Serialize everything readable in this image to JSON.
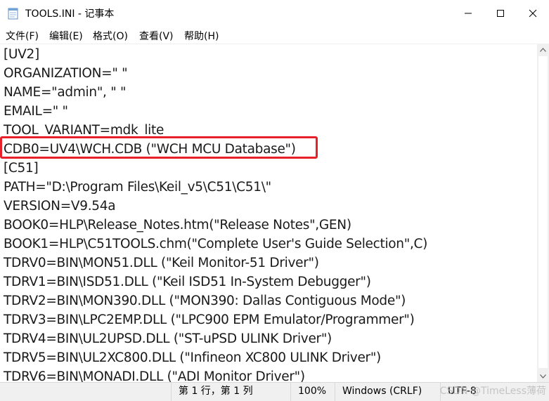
{
  "window": {
    "title": "TOOLS.INI - 记事本",
    "icon": "notepad-icon"
  },
  "menu": [
    "文件(F)",
    "编辑(E)",
    "格式(O)",
    "查看(V)",
    "帮助(H)"
  ],
  "editor_lines": [
    "[UV2]",
    "ORGANIZATION=\" \"",
    "NAME=\"admin\", \" \"",
    "EMAIL=\" \"",
    "TOOL_VARIANT=mdk_lite",
    "CDB0=UV4\\WCH.CDB (\"WCH MCU Database\")",
    "[C51]",
    "PATH=\"D:\\Program Files\\Keil_v5\\C51\\C51\\\"",
    "VERSION=V9.54a",
    "BOOK0=HLP\\Release_Notes.htm(\"Release Notes\",GEN)",
    "BOOK1=HLP\\C51TOOLS.chm(\"Complete User's Guide Selection\",C)",
    "TDRV0=BIN\\MON51.DLL (\"Keil Monitor-51 Driver\")",
    "TDRV1=BIN\\ISD51.DLL (\"Keil ISD51 In-System Debugger\")",
    "TDRV2=BIN\\MON390.DLL (\"MON390: Dallas Contiguous Mode\")",
    "TDRV3=BIN\\LPC2EMP.DLL (\"LPC900 EPM Emulator/Programmer\")",
    "TDRV4=BIN\\UL2UPSD.DLL (\"ST-uPSD ULINK Driver\")",
    "TDRV5=BIN\\UL2XC800.DLL (\"Infineon XC800 ULINK Driver\")",
    "TDRV6=BIN\\MONADI.DLL (\"ADI Monitor Driver\")"
  ],
  "highlighted_line_index": 5,
  "highlight_color": "#e8202a",
  "status": {
    "position": "第 1 行，第 1 列",
    "zoom": "100%",
    "line_ending": "Windows (CRLF)",
    "encoding": "UTF-8"
  },
  "watermark": "CSDN @TimeLess薄荷"
}
